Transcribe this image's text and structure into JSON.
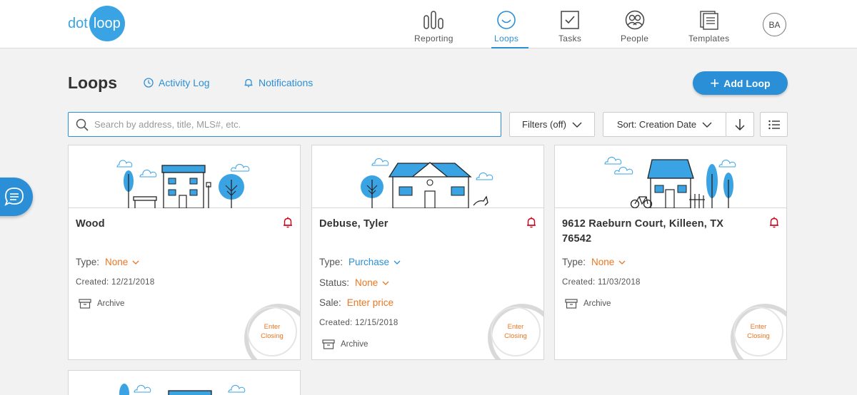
{
  "brand": {
    "dot": "dot",
    "loop": "loop"
  },
  "nav": {
    "reporting": "Reporting",
    "loops": "Loops",
    "tasks": "Tasks",
    "people": "People",
    "templates": "Templates",
    "avatar_initials": "BA"
  },
  "header": {
    "title": "Loops",
    "activity_log": "Activity Log",
    "notifications": "Notifications",
    "add_loop": "Add Loop"
  },
  "toolbar": {
    "search_placeholder": "Search by address, title, MLS#, etc.",
    "filters": "Filters (off)",
    "sort": "Sort: Creation Date"
  },
  "colors": {
    "accent": "#2a8fd6",
    "brand": "#3aa3e3",
    "warning": "#e87722",
    "alert": "#d0021b"
  },
  "cards": [
    {
      "title": "Wood",
      "type_label": "Type:",
      "type_value": "None",
      "created": "Created: 12/21/2018",
      "archive": "Archive",
      "closing_line1": "Enter",
      "closing_line2": "Closing"
    },
    {
      "title": "Debuse, Tyler",
      "type_label": "Type:",
      "type_value": "Purchase",
      "status_label": "Status:",
      "status_value": "None",
      "sale_label": "Sale:",
      "sale_value": "Enter price",
      "created": "Created: 12/15/2018",
      "archive": "Archive",
      "closing_line1": "Enter",
      "closing_line2": "Closing"
    },
    {
      "title": "9612 Raeburn Court, Killeen, TX 76542",
      "type_label": "Type:",
      "type_value": "None",
      "created": "Created: 11/03/2018",
      "archive": "Archive",
      "closing_line1": "Enter",
      "closing_line2": "Closing"
    }
  ]
}
